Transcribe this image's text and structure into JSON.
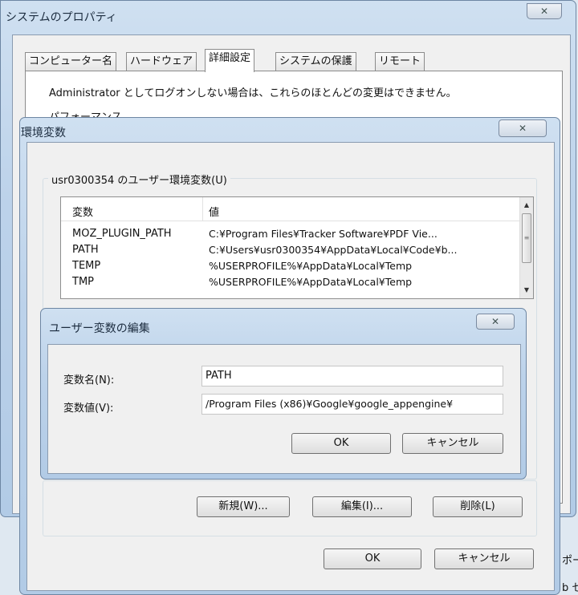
{
  "sys_props": {
    "title": "システムのプロパティ",
    "close_label": "✕",
    "tabs": [
      {
        "label": "コンピューター名"
      },
      {
        "label": "ハードウェア"
      },
      {
        "label": "詳細設定"
      },
      {
        "label": "システムの保護"
      },
      {
        "label": "リモート"
      }
    ],
    "info_text": "Administrator としてログオンしない場合は、これらのほとんどの変更はできません。",
    "perf_label": "パフォーマンス",
    "side_text_1": "ポー",
    "side_text_2": "b セ"
  },
  "env_dialog": {
    "title": "環境変数",
    "close_label": "✕",
    "user_section_label": "usr0300354 のユーザー環境変数(U)",
    "columns": {
      "var": "変数",
      "val": "値"
    },
    "rows": [
      {
        "var": "MOZ_PLUGIN_PATH",
        "val": "C:¥Program Files¥Tracker Software¥PDF Vie..."
      },
      {
        "var": "PATH",
        "val": "C:¥Users¥usr0300354¥AppData¥Local¥Code¥b..."
      },
      {
        "var": "TEMP",
        "val": "%USERPROFILE%¥AppData¥Local¥Temp"
      },
      {
        "var": "TMP",
        "val": "%USERPROFILE%¥AppData¥Local¥Temp"
      }
    ],
    "new_button": "新規(W)...",
    "edit_button": "編集(I)...",
    "delete_button": "削除(L)",
    "ok_button": "OK",
    "cancel_button": "キャンセル"
  },
  "edit_dialog": {
    "title": "ユーザー変数の編集",
    "close_label": "✕",
    "name_label": "変数名(N):",
    "name_value": "PATH",
    "value_label": "変数値(V):",
    "value_value": "/Program Files (x86)¥Google¥google_appengine¥",
    "ok_button": "OK",
    "cancel_button": "キャンセル"
  }
}
